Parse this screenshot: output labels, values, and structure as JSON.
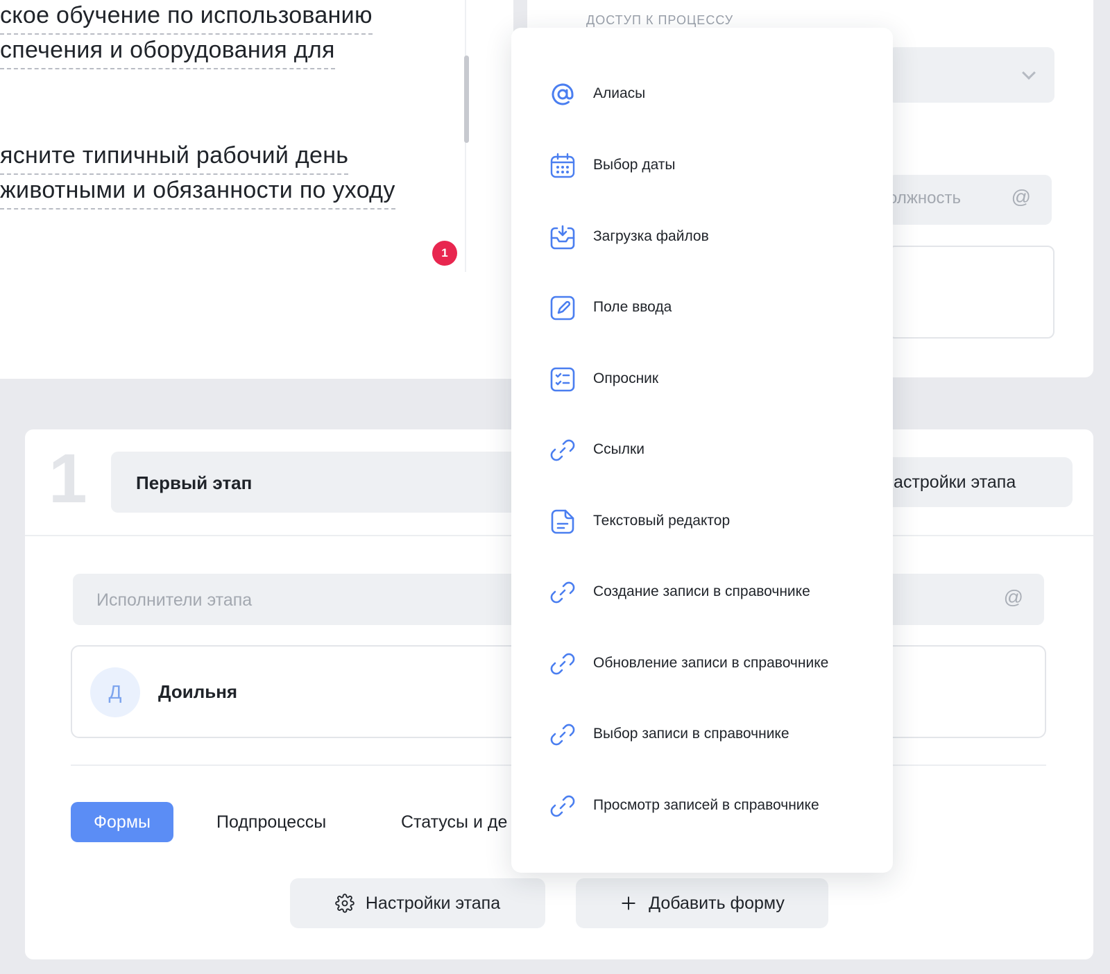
{
  "editor": {
    "lines": [
      "ское обучение по использованию",
      "спечения и оборудования для",
      "ясните типичный рабочий день",
      "животными и обязанности по уходу"
    ],
    "badge_count": "1"
  },
  "access": {
    "title": "доступ к процессу",
    "position_placeholder": "олжность",
    "at_symbol": "@"
  },
  "stage": {
    "number": "1",
    "name": "Первый этап",
    "settings_label": "Настройки этапа",
    "executors_placeholder": "Исполнители этапа",
    "at_symbol": "@",
    "assignee": {
      "initial": "Д",
      "name": "Доильня"
    },
    "tabs": [
      {
        "label": "Формы",
        "active": true
      },
      {
        "label": "Подпроцессы",
        "active": false
      },
      {
        "label": "Статусы и де",
        "active": false
      }
    ],
    "bottom_buttons": {
      "settings": "Настройки этапа",
      "add_form": "Добавить форму"
    }
  },
  "menu": {
    "items": [
      {
        "label": "Алиасы",
        "icon": "at-icon"
      },
      {
        "label": "Выбор даты",
        "icon": "calendar-icon"
      },
      {
        "label": "Загрузка файлов",
        "icon": "upload-tray-icon"
      },
      {
        "label": "Поле ввода",
        "icon": "edit-field-icon"
      },
      {
        "label": "Опросник",
        "icon": "checklist-icon"
      },
      {
        "label": "Ссылки",
        "icon": "link-icon"
      },
      {
        "label": "Текстовый редактор",
        "icon": "document-icon"
      },
      {
        "label": "Создание записи в справочнике",
        "icon": "link-icon"
      },
      {
        "label": "Обновление записи в справочнике",
        "icon": "link-icon"
      },
      {
        "label": "Выбор записи в справочнике",
        "icon": "link-icon"
      },
      {
        "label": "Просмотр записей в справочнике",
        "icon": "link-icon"
      }
    ]
  },
  "colors": {
    "accent": "#5b8df5",
    "icon_blue": "#4a7ef0",
    "badge": "#e8264f",
    "background": "#e9eaee"
  }
}
